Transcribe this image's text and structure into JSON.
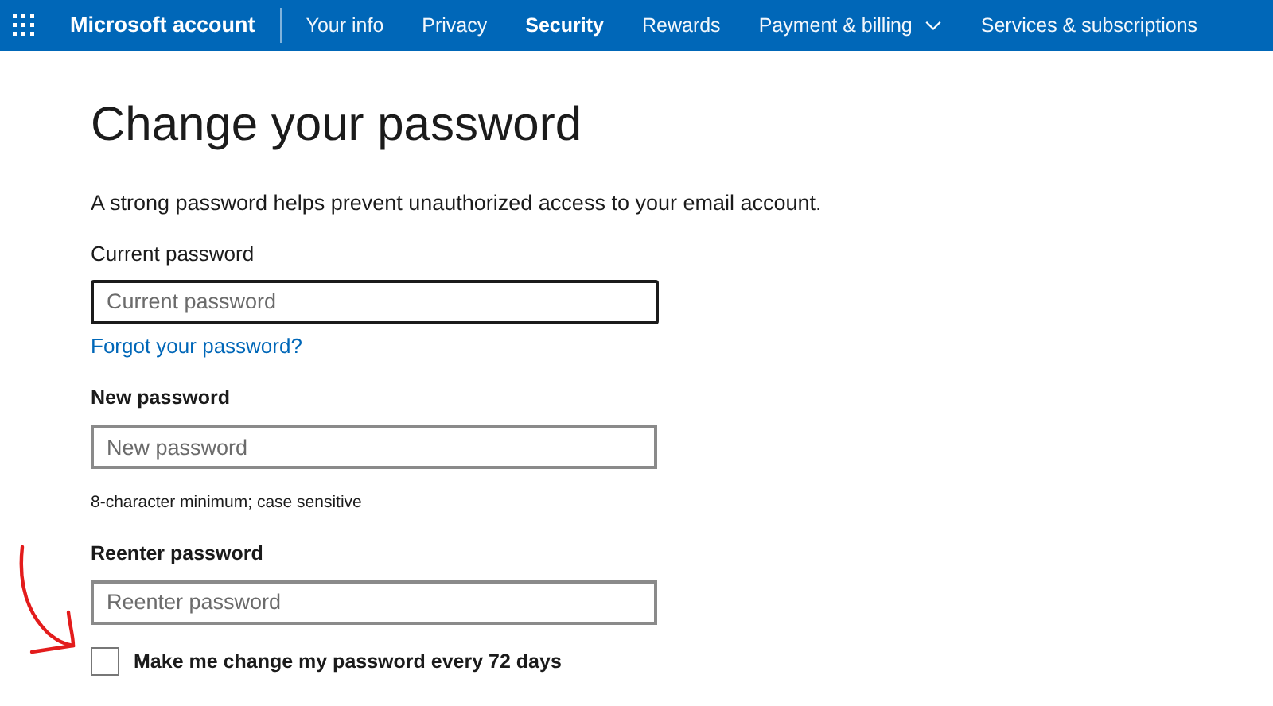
{
  "header": {
    "brand": "Microsoft account",
    "nav": [
      {
        "label": "Your info",
        "selected": false
      },
      {
        "label": "Privacy",
        "selected": false
      },
      {
        "label": "Security",
        "selected": true
      },
      {
        "label": "Rewards",
        "selected": false
      },
      {
        "label": "Payment & billing",
        "selected": false,
        "has_menu": true
      },
      {
        "label": "Services & subscriptions",
        "selected": false
      }
    ]
  },
  "title": "Change your password",
  "description": "A strong password helps prevent unauthorized access to your email account.",
  "fields": [
    {
      "label": "Current password",
      "placeholder": "Current password",
      "focused": true,
      "link": "Forgot your password?"
    },
    {
      "label": "New password",
      "placeholder": "New password",
      "focused": false,
      "hint": "8-character minimum; case sensitive"
    },
    {
      "label": "Reenter password",
      "placeholder": "Reenter password",
      "focused": false
    }
  ],
  "checkbox": {
    "label": "Make me change my password every 72 days",
    "checked": false
  }
}
